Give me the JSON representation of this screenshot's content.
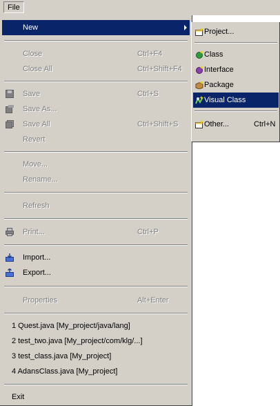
{
  "menubar": {
    "file_label": "File"
  },
  "file_menu": {
    "new": {
      "label": "New"
    },
    "close": {
      "label": "Close",
      "shortcut": "Ctrl+F4"
    },
    "close_all": {
      "label": "Close All",
      "shortcut": "Ctrl+Shift+F4"
    },
    "save": {
      "label": "Save",
      "shortcut": "Ctrl+S"
    },
    "save_as": {
      "label": "Save As..."
    },
    "save_all": {
      "label": "Save All",
      "shortcut": "Ctrl+Shift+S"
    },
    "revert": {
      "label": "Revert"
    },
    "move": {
      "label": "Move..."
    },
    "rename": {
      "label": "Rename..."
    },
    "refresh": {
      "label": "Refresh"
    },
    "print": {
      "label": "Print...",
      "shortcut": "Ctrl+P"
    },
    "import": {
      "label": "Import..."
    },
    "export": {
      "label": "Export..."
    },
    "properties": {
      "label": "Properties",
      "shortcut": "Alt+Enter"
    },
    "recent": [
      {
        "label": "1 Quest.java  [My_project/java/lang]"
      },
      {
        "label": "2 test_two.java  [My_project/com/klg/...]"
      },
      {
        "label": "3 test_class.java  [My_project]"
      },
      {
        "label": "4 AdansClass.java  [My_project]"
      }
    ],
    "exit": {
      "label": "Exit"
    }
  },
  "new_submenu": {
    "project": {
      "label": "Project..."
    },
    "class": {
      "label": "Class"
    },
    "interface": {
      "label": "Interface"
    },
    "package": {
      "label": "Package"
    },
    "visual_class": {
      "label": "Visual Class"
    },
    "other": {
      "label": "Other...",
      "shortcut": "Ctrl+N"
    }
  },
  "colors": {
    "menu_bg": "#d4d0c8",
    "highlight": "#0a246a",
    "disabled_text": "#808080"
  }
}
